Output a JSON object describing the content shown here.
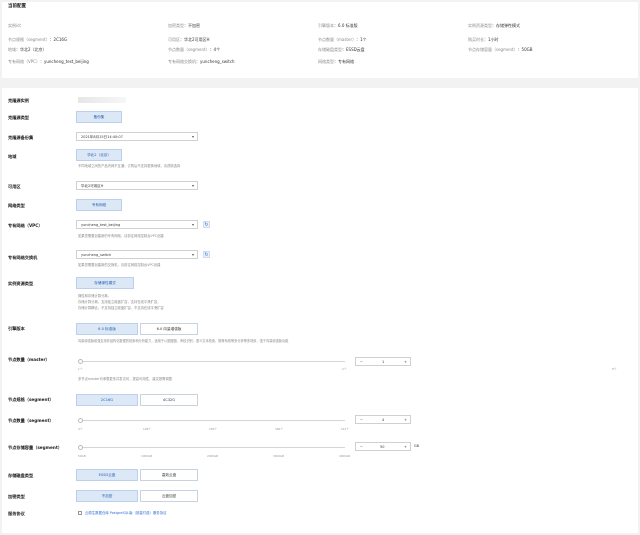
{
  "summary": {
    "title": "当前配置",
    "col1": [
      {
        "label": "实例id",
        "value": ""
      },
      {
        "label": "节点规格（segment）",
        "value": "2C16G"
      },
      {
        "label": "地域",
        "value": "华北2（北京）"
      },
      {
        "label": "专有网络（VPC）",
        "value": "yuncheng_test_beijing"
      }
    ],
    "col2": [
      {
        "label": "加密类型",
        "value": "不加密"
      },
      {
        "label": "可用区",
        "value": "华北2可用区H"
      },
      {
        "label": "节点数量（segment）",
        "value": "4个"
      },
      {
        "label": "专有网络交换机",
        "value": "yuncheng_switch"
      }
    ],
    "col3": [
      {
        "label": "引擎版本",
        "value": "6.0 标准版"
      },
      {
        "label": "节点数量（master）",
        "value": "1个"
      },
      {
        "label": "存储磁盘类型",
        "value": "ESSD云盘"
      },
      {
        "label": "网络类型",
        "value": "专有网络"
      }
    ],
    "col4": [
      {
        "label": "实例资源类型",
        "value": "存储弹性模式"
      },
      {
        "label": "购买时长",
        "value": "1小时"
      },
      {
        "label": "节点存储容量（segment）",
        "value": "50GB"
      }
    ]
  },
  "form": {
    "clone_source_label": "克隆源实例",
    "clone_type_label": "克隆源类型",
    "clone_type_button": "备份集",
    "backup_label": "克隆源备份集",
    "backup_value": "2021年8月15日14:40:07",
    "region_label": "地域",
    "region_button": "华北2（北京）",
    "region_hint": "不同地域之间的产品内网不互通；订购后不支持更换地域，请谨慎选择",
    "zone_label": "可用区",
    "zone_value": "华北2可用区H",
    "network_type_label": "网络类型",
    "network_type_button": "专有网络",
    "vpc_label": "专有网络（VPC）",
    "vpc_value": "yuncheng_test_beijing",
    "vpc_hint": "如果您需要创建新的专有网络，请前往网络控制台VPC创建",
    "vswitch_label": "专有网络交换机",
    "vswitch_value": "yuncheng_switch",
    "vswitch_hint": "如果您需要创建新的交换机，请前往网络控制台VPC创建",
    "resource_type_label": "实例资源类型",
    "resource_type_button": "存储弹性模式",
    "resource_desc": [
      "弹性和存储计算分离，",
      "存储计算分离，支持独立磁盘扩容，支持在线平滑扩容，",
      "存储计算耦合，不支持独立磁盘扩容，不支持在线平滑扩容"
    ],
    "engine_label": "引擎版本",
    "engine_options": [
      "6.0 标准版",
      "6.0 向量增强版"
    ],
    "engine_hint": "向量增强版增强支持非结构化数据的检索和分析能力，适用于以图搜图、声纹识别、语义文本检索、推荐系统等多分析等多场景，强于向量增强版功能",
    "master_label": "节点数量（master）",
    "master_min": "1个",
    "master_mid": "2个",
    "master_max": "8个",
    "master_value": "1",
    "master_hint": "多节点master可承载更多并发访问，提高可用性，建议按需调整",
    "spec_label": "节点规格（segment）",
    "spec_options": [
      "2C16G",
      "4C32G"
    ],
    "seg_count_label": "节点数量（segment）",
    "seg_ticks": [
      "4个",
      "128个",
      "256个",
      "384个",
      "512个"
    ],
    "seg_value": "4",
    "storage_label": "节点存储容量（segment）",
    "storage_ticks": [
      "50GB",
      "1000GB",
      "2000GB",
      "3000GB",
      "4000GB"
    ],
    "storage_value": "50",
    "storage_unit": "GB",
    "disk_label": "存储磁盘类型",
    "disk_options": [
      "ESSD云盘",
      "高效云盘"
    ],
    "encrypt_label": "加密类型",
    "encrypt_options": [
      "不加密",
      "云盘加密"
    ],
    "service_label": "服务协议",
    "service_text": "云原生数据仓库 PostgreSQL版（按量付费）服务协议"
  }
}
